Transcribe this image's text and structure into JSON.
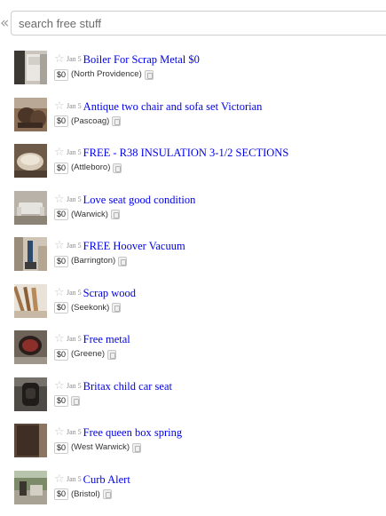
{
  "search": {
    "placeholder": "search free stuff",
    "value": "",
    "collapse_label": "«"
  },
  "listings": [
    {
      "date": "Jan 5",
      "title": "Boiler For Scrap Metal $0",
      "price": "$0",
      "hood": "(North Providence)",
      "thumb": "boiler"
    },
    {
      "date": "Jan 5",
      "title": "Antique two chair and sofa set Victorian",
      "price": "$0",
      "hood": "(Pascoag)",
      "thumb": "sofa"
    },
    {
      "date": "Jan 5",
      "title": "FREE - R38 INSULATION 3-1/2 SECTIONS",
      "price": "$0",
      "hood": "(Attleboro)",
      "thumb": "insulation"
    },
    {
      "date": "Jan 5",
      "title": "Love seat good condition",
      "price": "$0",
      "hood": "(Warwick)",
      "thumb": "loveseat"
    },
    {
      "date": "Jan 5",
      "title": "FREE Hoover Vacuum",
      "price": "$0",
      "hood": "(Barrington)",
      "thumb": "vacuum"
    },
    {
      "date": "Jan 5",
      "title": "Scrap wood",
      "price": "$0",
      "hood": "(Seekonk)",
      "thumb": "wood"
    },
    {
      "date": "Jan 5",
      "title": "Free metal",
      "price": "$0",
      "hood": "(Greene)",
      "thumb": "metal"
    },
    {
      "date": "Jan 5",
      "title": "Britax child car seat",
      "price": "$0",
      "hood": "",
      "thumb": "carseat"
    },
    {
      "date": "Jan 5",
      "title": "Free queen box spring",
      "price": "$0",
      "hood": "(West Warwick)",
      "thumb": "boxspring"
    },
    {
      "date": "Jan 5",
      "title": "Curb Alert",
      "price": "$0",
      "hood": "(Bristol)",
      "thumb": "curb"
    }
  ],
  "colors": {
    "link": "#0000ee",
    "star": "#c8c8c8",
    "date": "#888888",
    "border": "#cccccc"
  },
  "icons": {
    "star": "star-icon",
    "hide": "hide-icon",
    "collapse": "double-chevron-left-icon"
  }
}
